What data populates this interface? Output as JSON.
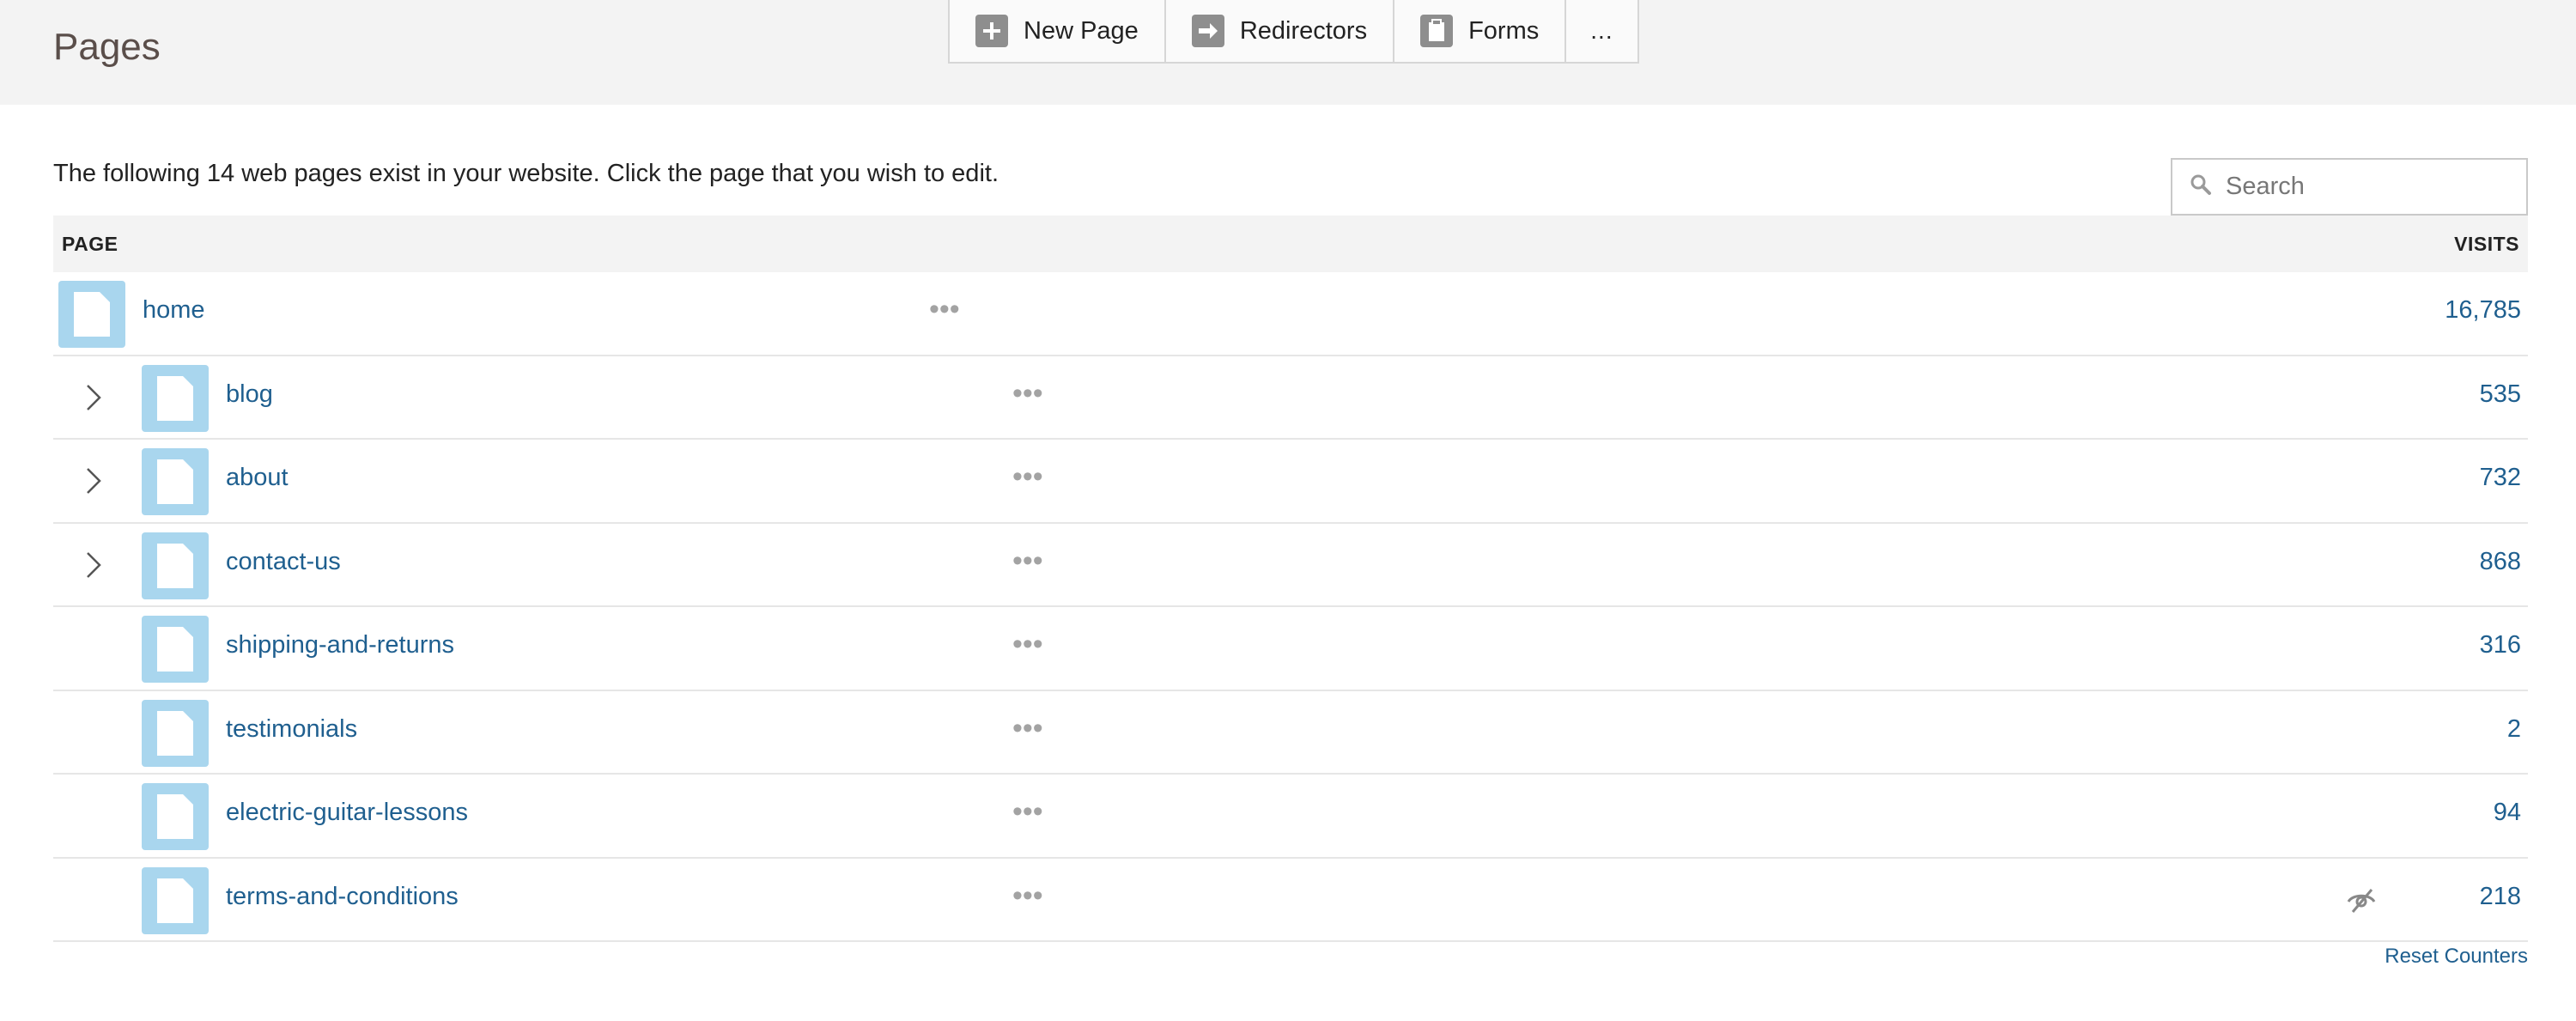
{
  "header": {
    "title": "Pages",
    "toolbar": {
      "new_page": "New Page",
      "redirectors": "Redirectors",
      "forms": "Forms",
      "more": "..."
    }
  },
  "intro_text": "The following 14 web pages exist in your website. Click the page that you wish to edit.",
  "search": {
    "placeholder": "Search"
  },
  "table": {
    "col_page": "PAGE",
    "col_visits": "VISITS",
    "rows": [
      {
        "name": "home",
        "visits": "16,785",
        "indent": 0,
        "expandable": false
      },
      {
        "name": "blog",
        "visits": "535",
        "indent": 1,
        "expandable": true
      },
      {
        "name": "about",
        "visits": "732",
        "indent": 1,
        "expandable": true
      },
      {
        "name": "contact-us",
        "visits": "868",
        "indent": 1,
        "expandable": true
      },
      {
        "name": "shipping-and-returns",
        "visits": "316",
        "indent": 1,
        "expandable": false
      },
      {
        "name": "testimonials",
        "visits": "2",
        "indent": 1,
        "expandable": false
      },
      {
        "name": "electric-guitar-lessons",
        "visits": "94",
        "indent": 1,
        "expandable": false
      },
      {
        "name": "terms-and-conditions",
        "visits": "218",
        "indent": 1,
        "expandable": false,
        "nofollow_icon": "eye-off-icon"
      }
    ]
  },
  "row_menu_label": "•••",
  "footer": {
    "reset_counters": "Reset Counters"
  },
  "colors": {
    "link": "#1f5f8f",
    "page_icon_bg": "#a9d6ee",
    "header_bg": "#f3f3f3",
    "title": "#5a4e4a"
  }
}
